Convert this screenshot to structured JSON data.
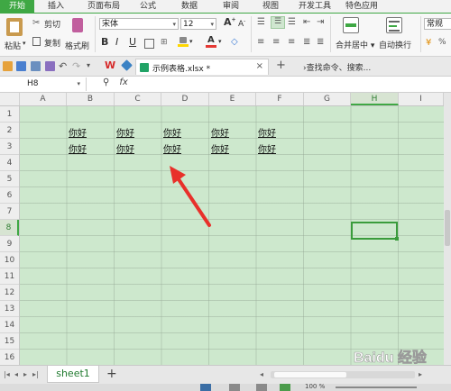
{
  "tabs": [
    "开始",
    "插入",
    "页面布局",
    "公式",
    "数据",
    "审阅",
    "视图",
    "开发工具",
    "特色应用"
  ],
  "ribbon": {
    "paste": "粘贴",
    "cut": "剪切",
    "copy": "复制",
    "format_painter": "格式刷",
    "font_name": "宋体",
    "font_size": "12",
    "bold": "B",
    "italic": "I",
    "underline": "U",
    "grow_font": "A",
    "shrink_font": "A",
    "merge_center": "合并居中",
    "wrap_text": "自动换行",
    "number_format": "常规"
  },
  "quickbar": {
    "file_name": "示例表格.xlsx *",
    "search": "查找命令、搜索..."
  },
  "formula_bar": {
    "cell_ref": "H8",
    "fx": "fx"
  },
  "columns": [
    "A",
    "B",
    "C",
    "D",
    "E",
    "F",
    "G",
    "H",
    "I"
  ],
  "rows": [
    "1",
    "2",
    "3",
    "4",
    "5",
    "6",
    "7",
    "8",
    "9",
    "10",
    "11",
    "12",
    "13",
    "14",
    "15",
    "16"
  ],
  "selected_cell": "H8",
  "cell_text": "你好",
  "cells": [
    {
      "ref": "B2",
      "text": "你好"
    },
    {
      "ref": "C2",
      "text": "你好"
    },
    {
      "ref": "D2",
      "text": "你好"
    },
    {
      "ref": "E2",
      "text": "你好"
    },
    {
      "ref": "F2",
      "text": "你好"
    },
    {
      "ref": "B3",
      "text": "你好"
    },
    {
      "ref": "C3",
      "text": "你好"
    },
    {
      "ref": "D3",
      "text": "你好"
    },
    {
      "ref": "E3",
      "text": "你好"
    },
    {
      "ref": "F3",
      "text": "你好"
    }
  ],
  "sheet": {
    "tab": "sheet1"
  },
  "status": {
    "zoom": "100 %"
  },
  "watermark": "Baidu 经验",
  "colors": {
    "accent": "#3fa844",
    "cell_bg": "#cde8cd",
    "arrow": "#e8302a"
  }
}
